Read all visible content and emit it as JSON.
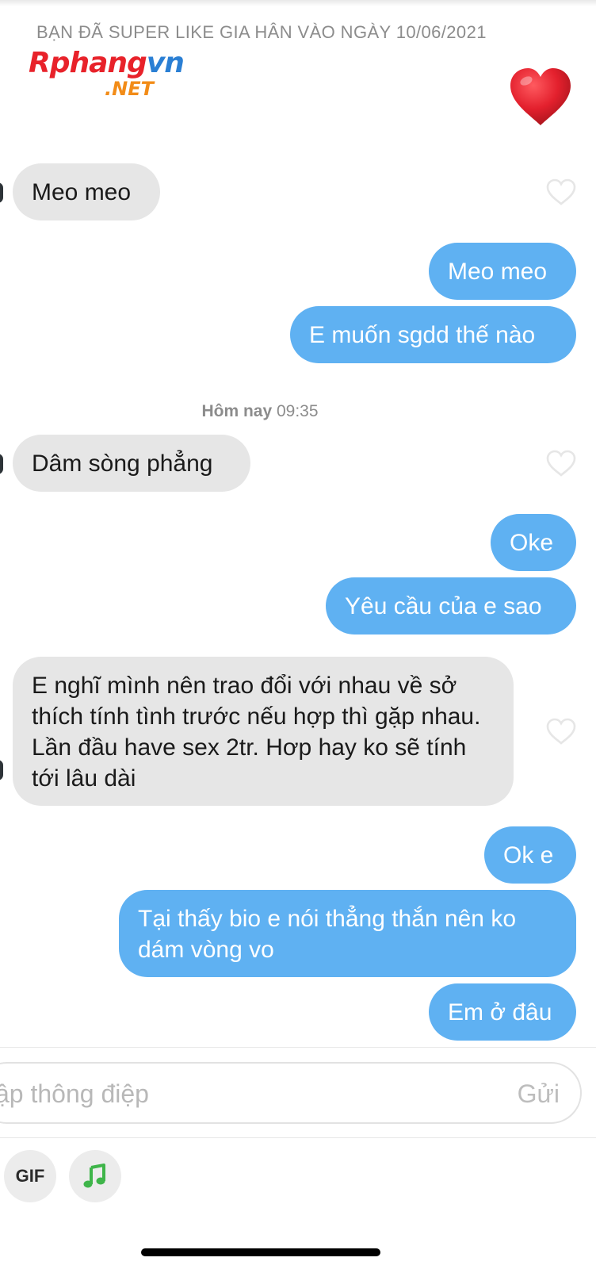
{
  "header": {
    "super_like_notice": "BẠN ĐÃ SUPER LIKE GIA HÂN VÀO NGÀY 10/06/2021",
    "watermark_main_1": "R",
    "watermark_main_2": "phang",
    "watermark_main_3": "vn",
    "watermark_sub": ".NET",
    "super_like_icon": "heart-icon"
  },
  "conversation": {
    "timestamp_day": "Hôm nay",
    "timestamp_time": "09:35",
    "messages": [
      {
        "direction": "incoming",
        "text": "Meo meo"
      },
      {
        "direction": "outgoing",
        "text": "Meo meo"
      },
      {
        "direction": "outgoing",
        "text": "E muốn sgdd thế nào"
      },
      {
        "direction": "incoming",
        "text": "Dâm sòng phẳng"
      },
      {
        "direction": "outgoing",
        "text": "Oke"
      },
      {
        "direction": "outgoing",
        "text": "Yêu cầu của e sao"
      },
      {
        "direction": "incoming",
        "text": "E nghĩ mình nên trao đổi với nhau về sở thích tính tình trước nếu hợp thì gặp nhau. Lần đầu have sex 2tr. Hơp hay ko sẽ tính tới lâu dài"
      },
      {
        "direction": "outgoing",
        "text": "Ok e"
      },
      {
        "direction": "outgoing",
        "text": "Tại thấy bio e nói thẳng thắn nên ko dám vòng vo"
      },
      {
        "direction": "outgoing",
        "text": "Em ở đâu"
      }
    ],
    "like_icon": "heart-outline-icon"
  },
  "composer": {
    "placeholder": "ập thông điệp",
    "send_label": "Gửi"
  },
  "toolbar": {
    "gif_label": "GIF",
    "music_icon": "music-note-icon"
  },
  "colors": {
    "incoming_bubble": "#e6e6e6",
    "outgoing_bubble": "#5fb1f2",
    "super_like_heart": "#e3202d",
    "music_icon": "#3fb54a"
  }
}
